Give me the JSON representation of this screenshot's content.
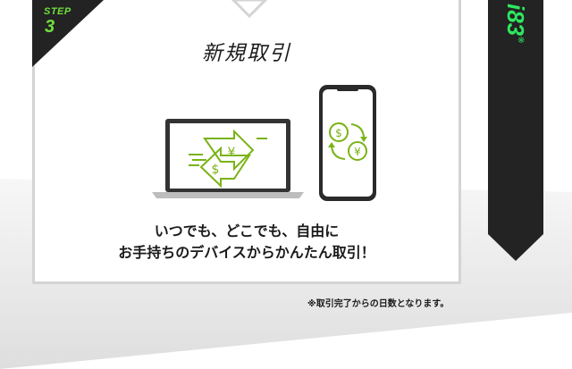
{
  "step": {
    "label": "STEP",
    "number": "3"
  },
  "card": {
    "title": "新規取引",
    "description_line1": "いつでも、どこでも、自由に",
    "description_line2": "お手持ちのデバイスからかんたん取引！"
  },
  "banner": {
    "text": "i83",
    "mark": "※"
  },
  "footnote": "※取引完了からの日数となります。",
  "icons": {
    "laptop": "laptop-exchange-icon",
    "phone": "smartphone-exchange-icon",
    "currencies": [
      "$",
      "¥"
    ]
  },
  "colors": {
    "accent_green": "#6fe03b",
    "icon_green": "#7ab317",
    "banner_bg": "#232323",
    "banner_text": "#2ee860",
    "card_border": "#d4d4d4",
    "background_gray": "#e6e6e6"
  }
}
